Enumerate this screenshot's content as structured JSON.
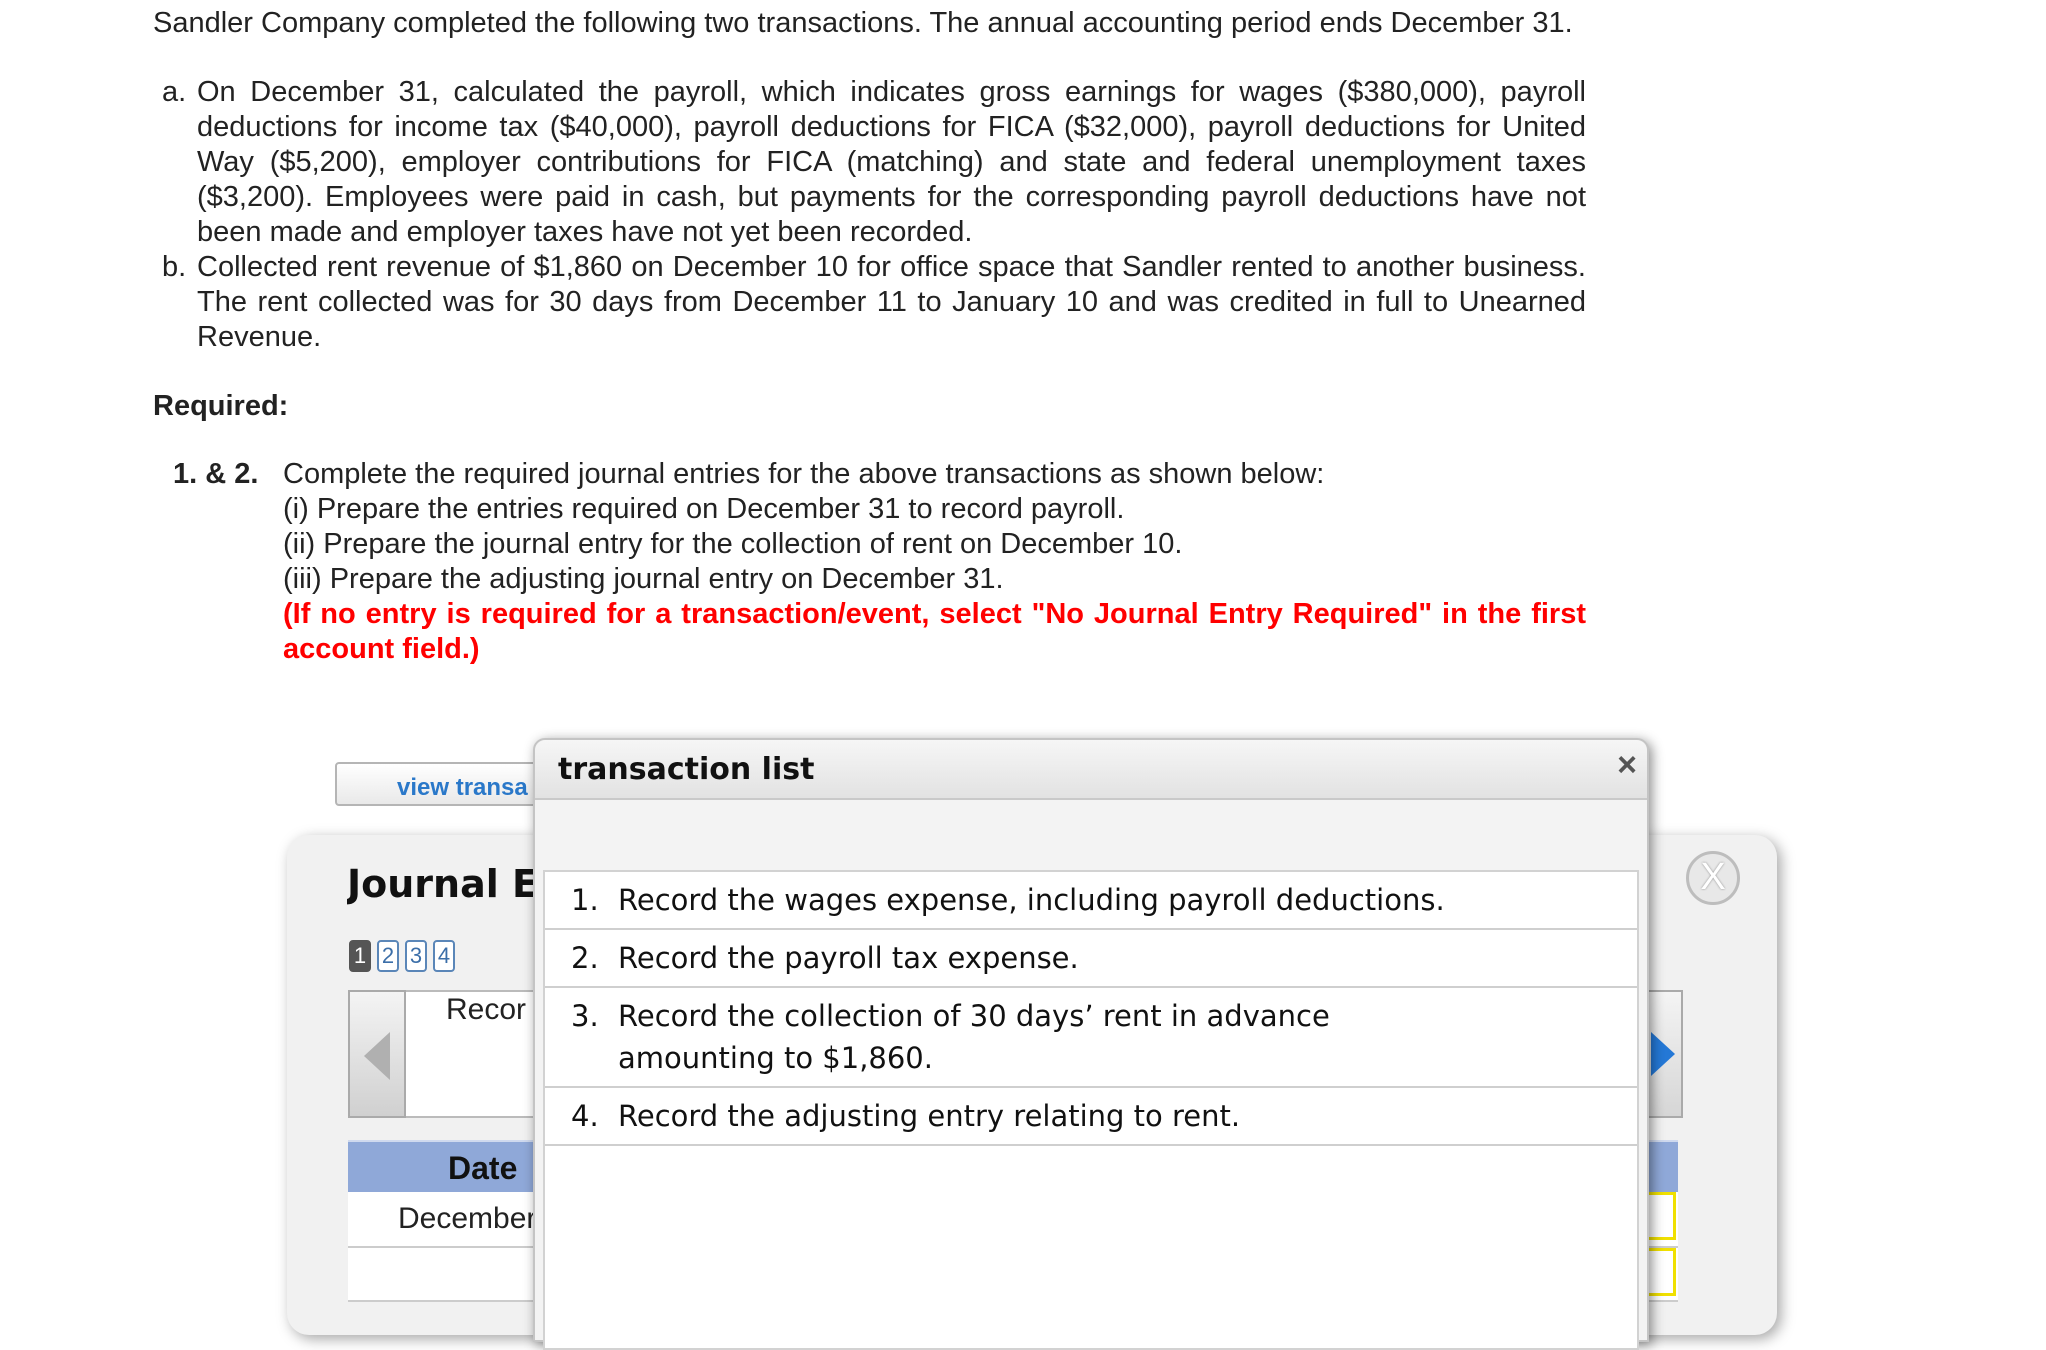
{
  "problem": {
    "intro": "Sandler Company completed the following two transactions. The annual accounting period ends December 31.",
    "transactions": [
      {
        "letter": "a.",
        "text": "On December 31, calculated the payroll, which indicates gross earnings for wages ($380,000), payroll deductions for income tax ($40,000), payroll deductions for FICA ($32,000), payroll deductions for United Way ($5,200), employer contributions for FICA (matching) and state and federal unemployment taxes ($3,200). Employees were paid in cash, but payments for the corresponding payroll deductions have not been made and employer taxes have not yet been recorded."
      },
      {
        "letter": "b.",
        "text": "Collected rent revenue of $1,860 on December 10 for office space that Sandler rented to another business. The rent collected was for 30 days from December 11 to January 10 and was credited in full to Unearned Revenue."
      }
    ],
    "required_heading": "Required:",
    "required": {
      "number": "1. & 2.",
      "lines": [
        "Complete the required journal entries for the above transactions as shown below:",
        "(i) Prepare the entries required on December 31 to record payroll.",
        "(ii) Prepare the journal entry for the collection of rent on December 10.",
        "(iii) Prepare the adjusting journal entry on December 31."
      ],
      "warning": "(If no entry is required for a transaction/event, select \"No Journal Entry Required\" in the first account field.)"
    }
  },
  "worksheet": {
    "view_button": "view transa",
    "title": "Journal E",
    "pages": [
      "1",
      "2",
      "3",
      "4"
    ],
    "record_label": "Recor",
    "table_header_date": "Date",
    "first_row_date": "December",
    "close_label": "X"
  },
  "dialog": {
    "title": "transaction list",
    "close": "×",
    "items": [
      {
        "num": "1.",
        "text": "Record the wages expense, including payroll deductions."
      },
      {
        "num": "2.",
        "text": "Record the payroll tax expense."
      },
      {
        "num": "3.",
        "text": "Record the collection of 30 days’ rent in advance amounting to $1,860."
      },
      {
        "num": "4.",
        "text": "Record the adjusting entry relating to rent."
      }
    ]
  },
  "colors": {
    "warning": "#ff0000",
    "link_blue": "#2a78c9",
    "table_header": "#8fa8d8",
    "nav_arrow": "#2478d6"
  }
}
